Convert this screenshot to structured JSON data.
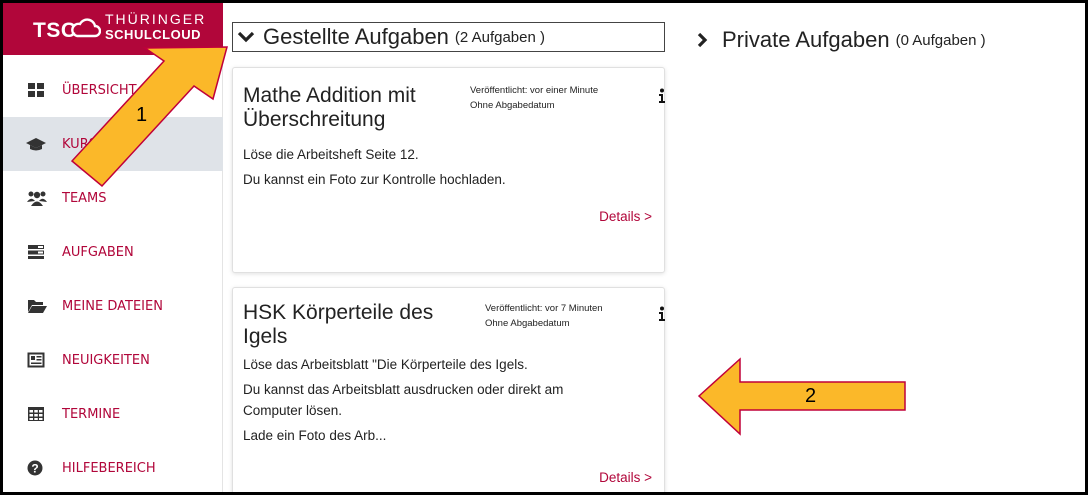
{
  "brand": {
    "short": "TSC",
    "line1": "THÜRINGER",
    "line2": "SCHULCLOUD"
  },
  "sidebar": {
    "items": [
      {
        "label": "ÜBERSICHT",
        "icon": "dashboard-icon"
      },
      {
        "label": "KURSE",
        "icon": "graduation-cap-icon",
        "active": true
      },
      {
        "label": "TEAMS",
        "icon": "users-icon"
      },
      {
        "label": "AUFGABEN",
        "icon": "tasks-icon"
      },
      {
        "label": "MEINE DATEIEN",
        "icon": "folder-open-icon"
      },
      {
        "label": "NEUIGKEITEN",
        "icon": "newspaper-icon"
      },
      {
        "label": "TERMINE",
        "icon": "calendar-grid-icon"
      },
      {
        "label": "HILFEBEREICH",
        "icon": "question-circle-icon"
      }
    ]
  },
  "sections": {
    "assigned": {
      "title": "Gestellte Aufgaben",
      "count": "(2 Aufgaben )"
    },
    "private": {
      "title": "Private Aufgaben",
      "count": "(0 Aufgaben )"
    }
  },
  "tasks": [
    {
      "title": "Mathe Addition mit Überschreitung",
      "published": "Veröffentlicht: vor einer Minute",
      "deadline": "Ohne Abgabedatum",
      "lines": [
        "Löse die Arbeitsheft Seite 12.",
        "Du kannst ein Foto zur Kontrolle hochladen."
      ],
      "details": "Details >"
    },
    {
      "title": "HSK Körperteile des Igels",
      "published": "Veröffentlicht: vor 7 Minuten",
      "deadline": "Ohne Abgabedatum",
      "lines": [
        "Löse das Arbeitsblatt \"Die Körperteile des Igels.",
        "Du kannst das Arbeitsblatt ausdrucken oder direkt am",
        "Computer lösen.",
        "Lade ein Foto des Arb..."
      ],
      "details": "Details >"
    }
  ],
  "annotations": {
    "arrow1": "1",
    "arrow2": "2",
    "arrow_fill": "#fbb829",
    "arrow_stroke": "#c0003a"
  },
  "colors": {
    "brand": "#b1063a",
    "nav_text": "#b1063a",
    "active_bg": "#dfe3e8"
  }
}
